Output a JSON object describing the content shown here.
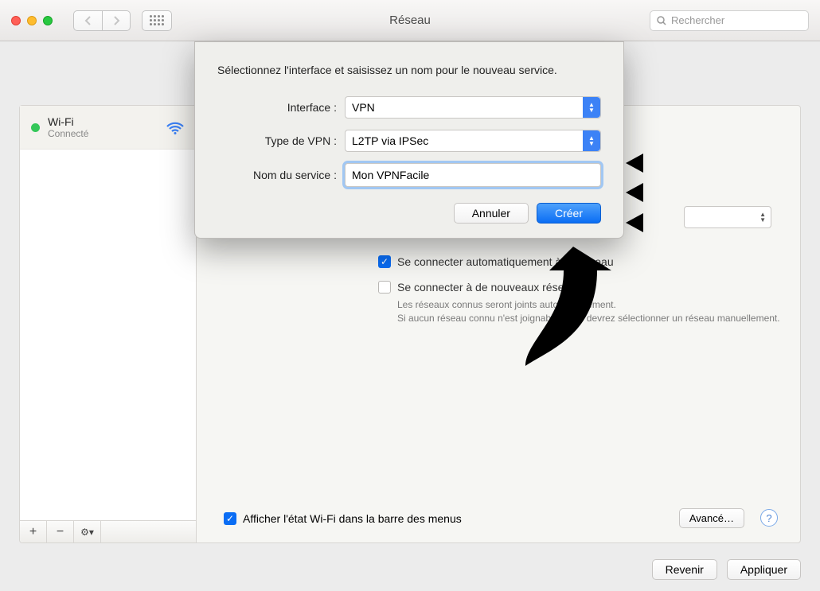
{
  "window": {
    "title": "Réseau",
    "search_placeholder": "Rechercher"
  },
  "sidebar": {
    "items": [
      {
        "name": "Wi-Fi",
        "status": "Connecté",
        "dot_color": "#34c759"
      }
    ],
    "toolbar": {
      "add": "+",
      "remove": "−",
      "gear": "⚙︎▾"
    }
  },
  "content": {
    "auto_connect_label": "Se connecter automatiquement à ce réseau",
    "new_networks_label": "Se connecter à de nouveaux réseaux",
    "new_networks_sub": "Les réseaux connus seront joints automatiquement.\nSi aucun réseau connu n'est joignable, vous devrez sélectionner un réseau manuellement.",
    "show_wifi_label": "Afficher l'état Wi-Fi dans la barre des menus",
    "advanced_label": "Avancé…",
    "help_label": "?"
  },
  "footer": {
    "revert": "Revenir",
    "apply": "Appliquer"
  },
  "sheet": {
    "prompt": "Sélectionnez l'interface et saisissez un nom pour le nouveau service.",
    "interface_label": "Interface :",
    "interface_value": "VPN",
    "vpn_type_label": "Type de VPN :",
    "vpn_type_value": "L2TP via IPSec",
    "service_name_label": "Nom du service :",
    "service_name_value": "Mon VPNFacile",
    "cancel": "Annuler",
    "create": "Créer"
  }
}
